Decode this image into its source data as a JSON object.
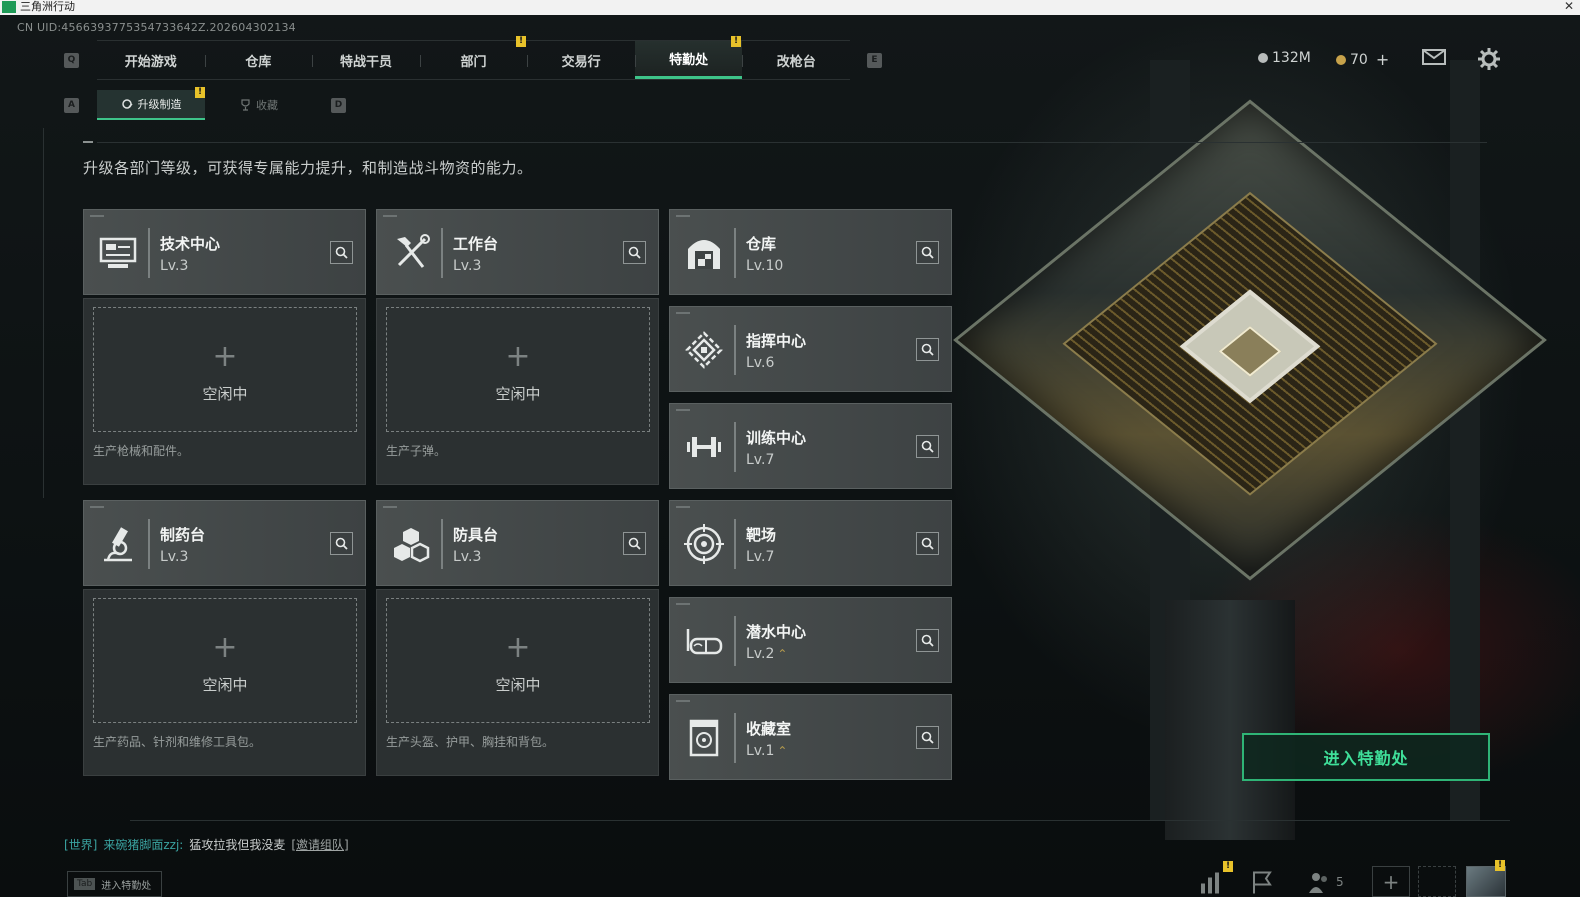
{
  "window": {
    "title": "三角洲行动"
  },
  "uid": "CN UID:4566393775354733642Z.202604302134",
  "keys": {
    "prev_main": "Q",
    "next_main": "E",
    "prev_sub": "A",
    "next_sub": "D"
  },
  "main_tabs": [
    {
      "label": "开始游戏",
      "active": false,
      "alert": false
    },
    {
      "label": "仓库",
      "active": false,
      "alert": false
    },
    {
      "label": "特战干员",
      "active": false,
      "alert": false
    },
    {
      "label": "部门",
      "active": false,
      "alert": true
    },
    {
      "label": "交易行",
      "active": false,
      "alert": false
    },
    {
      "label": "特勤处",
      "active": true,
      "alert": true
    },
    {
      "label": "改枪台",
      "active": false,
      "alert": false
    }
  ],
  "alert_mark": "!",
  "currency": {
    "money": "132M",
    "premium": "70",
    "premium_add": "+"
  },
  "sub_tabs": [
    {
      "label": "升级制造",
      "active": true,
      "alert": true
    },
    {
      "label": "收藏",
      "active": false,
      "alert": false
    }
  ],
  "description": "升级各部门等级，可获得专属能力提升，和制造战斗物资的能力。",
  "departments_left": [
    {
      "name": "技术中心",
      "level": "Lv.3",
      "icon": "monitor-icon",
      "idle_label": "空闲中",
      "production": "生产枪械和配件。"
    },
    {
      "name": "工作台",
      "level": "Lv.3",
      "icon": "tools-icon",
      "idle_label": "空闲中",
      "production": "生产子弹。"
    },
    {
      "name": "制药台",
      "level": "Lv.3",
      "icon": "microscope-icon",
      "idle_label": "空闲中",
      "production": "生产药品、针剂和维修工具包。"
    },
    {
      "name": "防具台",
      "level": "Lv.3",
      "icon": "boxes-icon",
      "idle_label": "空闲中",
      "production": "生产头盔、护甲、胸挂和背包。"
    }
  ],
  "departments_right": [
    {
      "name": "仓库",
      "level": "Lv.10",
      "icon": "warehouse-icon",
      "upgradable": false
    },
    {
      "name": "指挥中心",
      "level": "Lv.6",
      "icon": "command-icon",
      "upgradable": false
    },
    {
      "name": "训练中心",
      "level": "Lv.7",
      "icon": "dumbbell-icon",
      "upgradable": false
    },
    {
      "name": "靶场",
      "level": "Lv.7",
      "icon": "target-icon",
      "upgradable": false
    },
    {
      "name": "潜水中心",
      "level": "Lv.2",
      "icon": "goggles-icon",
      "upgradable": true
    },
    {
      "name": "收藏室",
      "level": "Lv.1",
      "icon": "vault-icon",
      "upgradable": true
    }
  ],
  "upgrade_mark": "⌃",
  "enter_button": "进入特勤处",
  "chat": {
    "channel": "[世界]",
    "sender": "来碗猪脚面zzj:",
    "message": "猛攻拉我但我没麦",
    "invite": "[邀请组队]"
  },
  "tab_hint": {
    "key": "Tab",
    "label": "进入特勤处"
  },
  "friends_online": "5",
  "colors": {
    "accent": "#3ec48a",
    "alert": "#e8c22a",
    "upgrade": "#b39a4d"
  }
}
